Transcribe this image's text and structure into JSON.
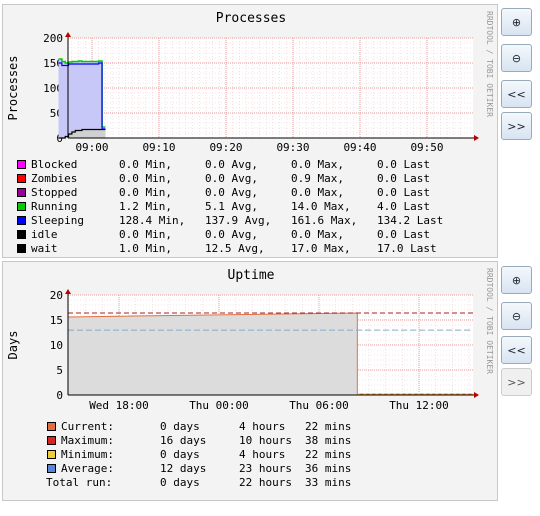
{
  "chart_data": [
    {
      "type": "area",
      "title": "Processes",
      "ylabel": "Processes",
      "side_label": "RRDTOOL / TOBI OETIKER",
      "ylim": [
        0,
        200
      ],
      "yticks": [
        "0",
        "50",
        "100",
        "150",
        "200"
      ],
      "xticks": [
        "09:00",
        "09:10",
        "09:20",
        "09:30",
        "09:40",
        "09:50"
      ],
      "grid": true,
      "series": [
        {
          "name": "Blocked",
          "color": "#ff00ff",
          "min": "0.0 Min,",
          "avg": "0.0 Avg,",
          "max": "0.0 Max,",
          "last": "0.0 Last"
        },
        {
          "name": "Zombies",
          "color": "#ff0000",
          "min": "0.0 Min,",
          "avg": "0.0 Avg,",
          "max": "0.9 Max,",
          "last": "0.0 Last"
        },
        {
          "name": "Stopped",
          "color": "#990099",
          "min": "0.0 Min,",
          "avg": "0.0 Avg,",
          "max": "0.0 Max,",
          "last": "0.0 Last"
        },
        {
          "name": "Running",
          "color": "#00cc00",
          "min": "1.2 Min,",
          "avg": "5.1 Avg,",
          "max": "14.0 Max,",
          "last": "4.0 Last"
        },
        {
          "name": "Sleeping",
          "color": "#0000ff",
          "min": "128.4 Min,",
          "avg": "137.9 Avg,",
          "max": "161.6 Max,",
          "last": "134.2 Last"
        },
        {
          "name": "idle",
          "color": "#000000",
          "min": "0.0 Min,",
          "avg": "0.0 Avg,",
          "max": "0.0 Max,",
          "last": "0.0 Last"
        },
        {
          "name": "wait",
          "color": "#000000",
          "min": "1.0 Min,",
          "avg": "12.5 Avg,",
          "max": "17.0 Max,",
          "last": "17.0 Last"
        }
      ],
      "data": {
        "x_minutes": [
          0,
          0.5,
          1,
          1.5,
          2,
          2.5,
          3,
          3.5,
          4,
          4.5,
          5,
          5.5,
          6,
          6.5
        ],
        "sleeping": [
          150,
          145,
          145,
          148,
          148,
          148,
          148,
          148,
          148,
          148,
          148,
          148,
          150,
          18
        ],
        "running": [
          8,
          8,
          5,
          4,
          5,
          5,
          6,
          5,
          5,
          5,
          5,
          5,
          4,
          4
        ],
        "wait": [
          0,
          0,
          3,
          8,
          12,
          15,
          15,
          17,
          17,
          17,
          17,
          17,
          17,
          17
        ]
      }
    },
    {
      "type": "area",
      "title": "Uptime",
      "ylabel": "Days",
      "side_label": "RRDTOOL / TOBI OETIKER",
      "ylim": [
        0,
        20
      ],
      "yticks": [
        "0",
        "5",
        "10",
        "15",
        "20"
      ],
      "xticks": [
        "Wed 18:00",
        "Thu 00:00",
        "Thu 06:00",
        "Thu 12:00"
      ],
      "grid": true,
      "current_days": 16.0,
      "maximum_days": 16.4,
      "average_days": 12.98,
      "series": [
        {
          "name": "Current:",
          "color": "#e07040",
          "d": "0 days",
          "h": "4 hours",
          "m": "22 mins"
        },
        {
          "name": "Maximum:",
          "color": "#dd2222",
          "d": "16 days",
          "h": "10 hours",
          "m": "38 mins"
        },
        {
          "name": "Minimum:",
          "color": "#eecc33",
          "d": "0 days",
          "h": "4 hours",
          "m": "22 mins"
        },
        {
          "name": "Average:",
          "color": "#5588dd",
          "d": "12 days",
          "h": "23 hours",
          "m": "36 mins"
        }
      ],
      "total": {
        "name": "Total run:",
        "d": "0 days",
        "h": "22 hours",
        "m": "33 mins"
      }
    }
  ],
  "controls": {
    "zoom_in": "⊕",
    "zoom_out": "⊖",
    "prev": "<<",
    "next": ">>"
  }
}
